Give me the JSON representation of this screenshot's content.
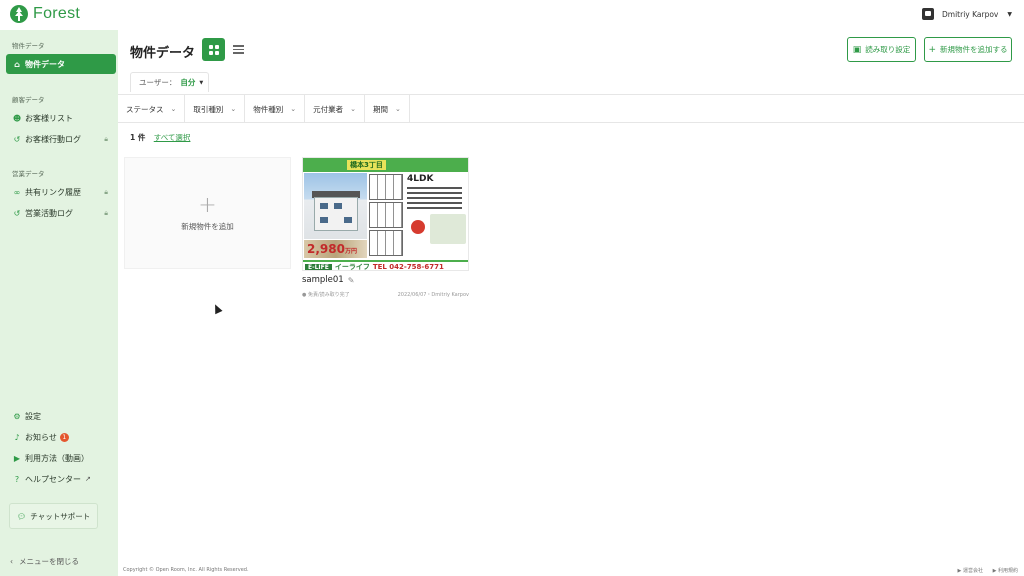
{
  "app": {
    "name": "Forest",
    "user_name": "Dmitriy Karpov"
  },
  "sidebar": {
    "sections": [
      {
        "label": "物件データ",
        "items": [
          {
            "label": "物件データ",
            "icon": "building-icon",
            "active": true
          }
        ]
      },
      {
        "label": "顧客データ",
        "items": [
          {
            "label": "お客様リスト",
            "icon": "people-icon"
          },
          {
            "label": "お客様行動ログ",
            "icon": "history-icon",
            "locked": true
          }
        ]
      },
      {
        "label": "営業データ",
        "items": [
          {
            "label": "共有リンク履歴",
            "icon": "link-icon",
            "locked": true
          },
          {
            "label": "営業活動ログ",
            "icon": "history-icon",
            "locked": true
          }
        ]
      }
    ],
    "bottom_items": [
      {
        "label": "設定",
        "icon": "gear-icon"
      },
      {
        "label": "お知らせ",
        "icon": "bell-icon",
        "badge": "1"
      },
      {
        "label": "利用方法（動画）",
        "icon": "video-icon"
      },
      {
        "label": "ヘルプセンター",
        "icon": "help-icon",
        "external": true
      }
    ],
    "chat_support": "チャットサポート",
    "collapse": "メニューを閉じる"
  },
  "header": {
    "title": "物件データ",
    "view_modes": [
      "grid",
      "list"
    ],
    "active_view": "grid",
    "read_settings_button": "読み取り設定",
    "add_property_button": "新規物件を追加する"
  },
  "user_filter": {
    "label": "ユーザー：",
    "value": "自分"
  },
  "filters": [
    "ステータス",
    "取引種別",
    "物件種別",
    "元付業者",
    "期間"
  ],
  "results": {
    "count": "1 件",
    "select_all": "すべて選択"
  },
  "add_card": {
    "label": "新規物件を追加"
  },
  "properties": [
    {
      "name": "sample01",
      "status": "●  免責/読み取り完了",
      "meta": "2022/06/07・Dmitriy Karpov",
      "flyer": {
        "headline": "橋本3丁目",
        "layout": "4LDK",
        "price": "2,980",
        "price_unit": "万円",
        "brand": "E-LIFE",
        "company": "イーライフ",
        "tel": "TEL 042-758-6771"
      }
    }
  ],
  "footer": {
    "copyright": "Copyright © Open Room, Inc. All Rights Reserved.",
    "links": [
      "▶ 運営会社",
      "▶ 利用規約"
    ]
  },
  "colors": {
    "accent": "#2f9a47",
    "sidebar_bg": "#e3f3e1",
    "badge": "#e4572e"
  }
}
